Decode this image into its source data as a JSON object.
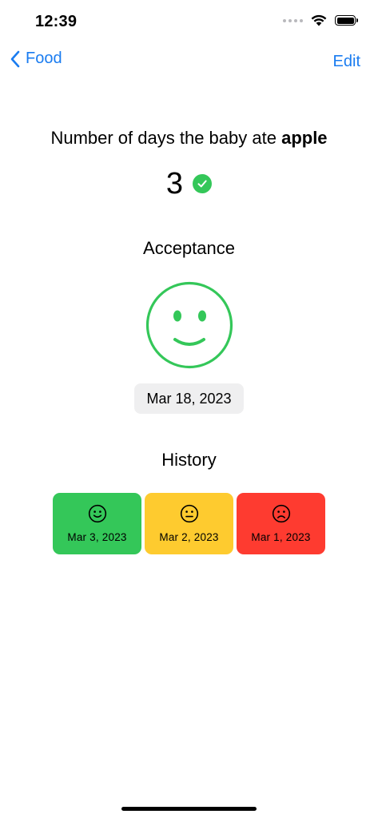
{
  "status_bar": {
    "time": "12:39"
  },
  "nav": {
    "back_label": "Food",
    "edit_label": "Edit"
  },
  "headline": {
    "prefix": "Number of days the baby ate ",
    "food": "apple"
  },
  "count": "3",
  "acceptance": {
    "title": "Acceptance",
    "face_icon": "smiling-face-icon",
    "face_color": "#34c759",
    "date": "Mar 18, 2023"
  },
  "history": {
    "title": "History",
    "items": [
      {
        "date": "Mar 3, 2023",
        "mood": "happy",
        "color": "#34c759",
        "icon": "happy-face-icon"
      },
      {
        "date": "Mar 2, 2023",
        "mood": "neutral",
        "color": "#fecb2f",
        "icon": "neutral-face-icon"
      },
      {
        "date": "Mar 1, 2023",
        "mood": "sad",
        "color": "#fe3b30",
        "icon": "sad-face-icon"
      }
    ]
  },
  "colors": {
    "accent": "#1a7cf0",
    "success": "#34c759",
    "date_button_bg": "#efeff0"
  }
}
